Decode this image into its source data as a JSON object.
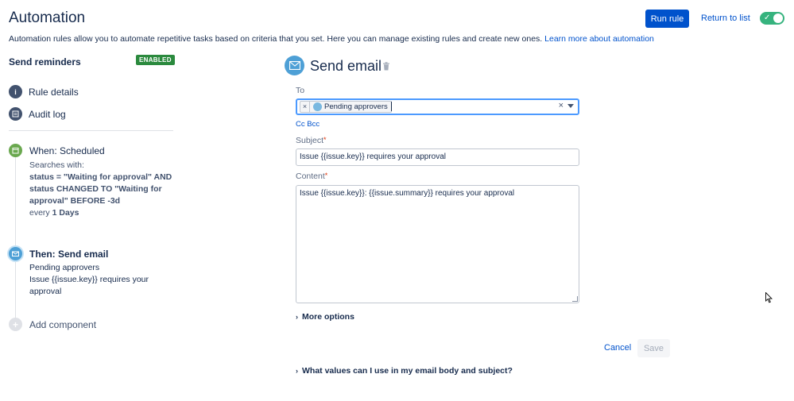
{
  "header": {
    "title": "Automation",
    "description": "Automation rules allow you to automate repetitive tasks based on criteria that you set. Here you can manage existing rules and create new ones.",
    "learn_more": "Learn more about automation",
    "run_rule": "Run rule",
    "return_to_list": "Return to list",
    "toggle_enabled": true
  },
  "sidebar": {
    "rule_name": "Send reminders",
    "status_badge": "ENABLED",
    "nav": [
      {
        "label": "Rule details",
        "icon": "info-icon"
      },
      {
        "label": "Audit log",
        "icon": "list-icon"
      }
    ],
    "steps": {
      "when": {
        "title": "When: Scheduled",
        "line1": "Searches with:",
        "jql_line1": "status = \"Waiting for approval\" AND",
        "jql_line2": "status CHANGED TO \"Waiting for",
        "jql_line3": "approval\" BEFORE -3d",
        "every_prefix": "every",
        "every_value": "1 Days",
        "icon": "calendar-icon"
      },
      "then": {
        "title": "Then: Send email",
        "line1": "Pending approvers",
        "line2": "Issue {{issue.key}} requires your",
        "line3": "approval",
        "icon": "envelope-icon"
      },
      "add": {
        "label": "Add component",
        "icon": "plus-icon"
      }
    }
  },
  "form": {
    "title": "Send email",
    "to_label": "To",
    "to_chip": "Pending approvers",
    "cc_bcc": "Cc Bcc",
    "subject_label": "Subject",
    "subject_value": "Issue {{issue.key}} requires your approval",
    "content_label": "Content",
    "content_value": "Issue {{issue.key}}: {{issue.summary}} requires your approval",
    "more_options": "More options",
    "help_expander": "What values can I use in my email body and subject?",
    "cancel": "Cancel",
    "save": "Save"
  },
  "colors": {
    "primary": "#0052cc",
    "enabled_green": "#2b8a3e",
    "toggle_green": "#36b37e",
    "email_blue": "#4ea0d6",
    "when_green": "#6aa84f"
  }
}
